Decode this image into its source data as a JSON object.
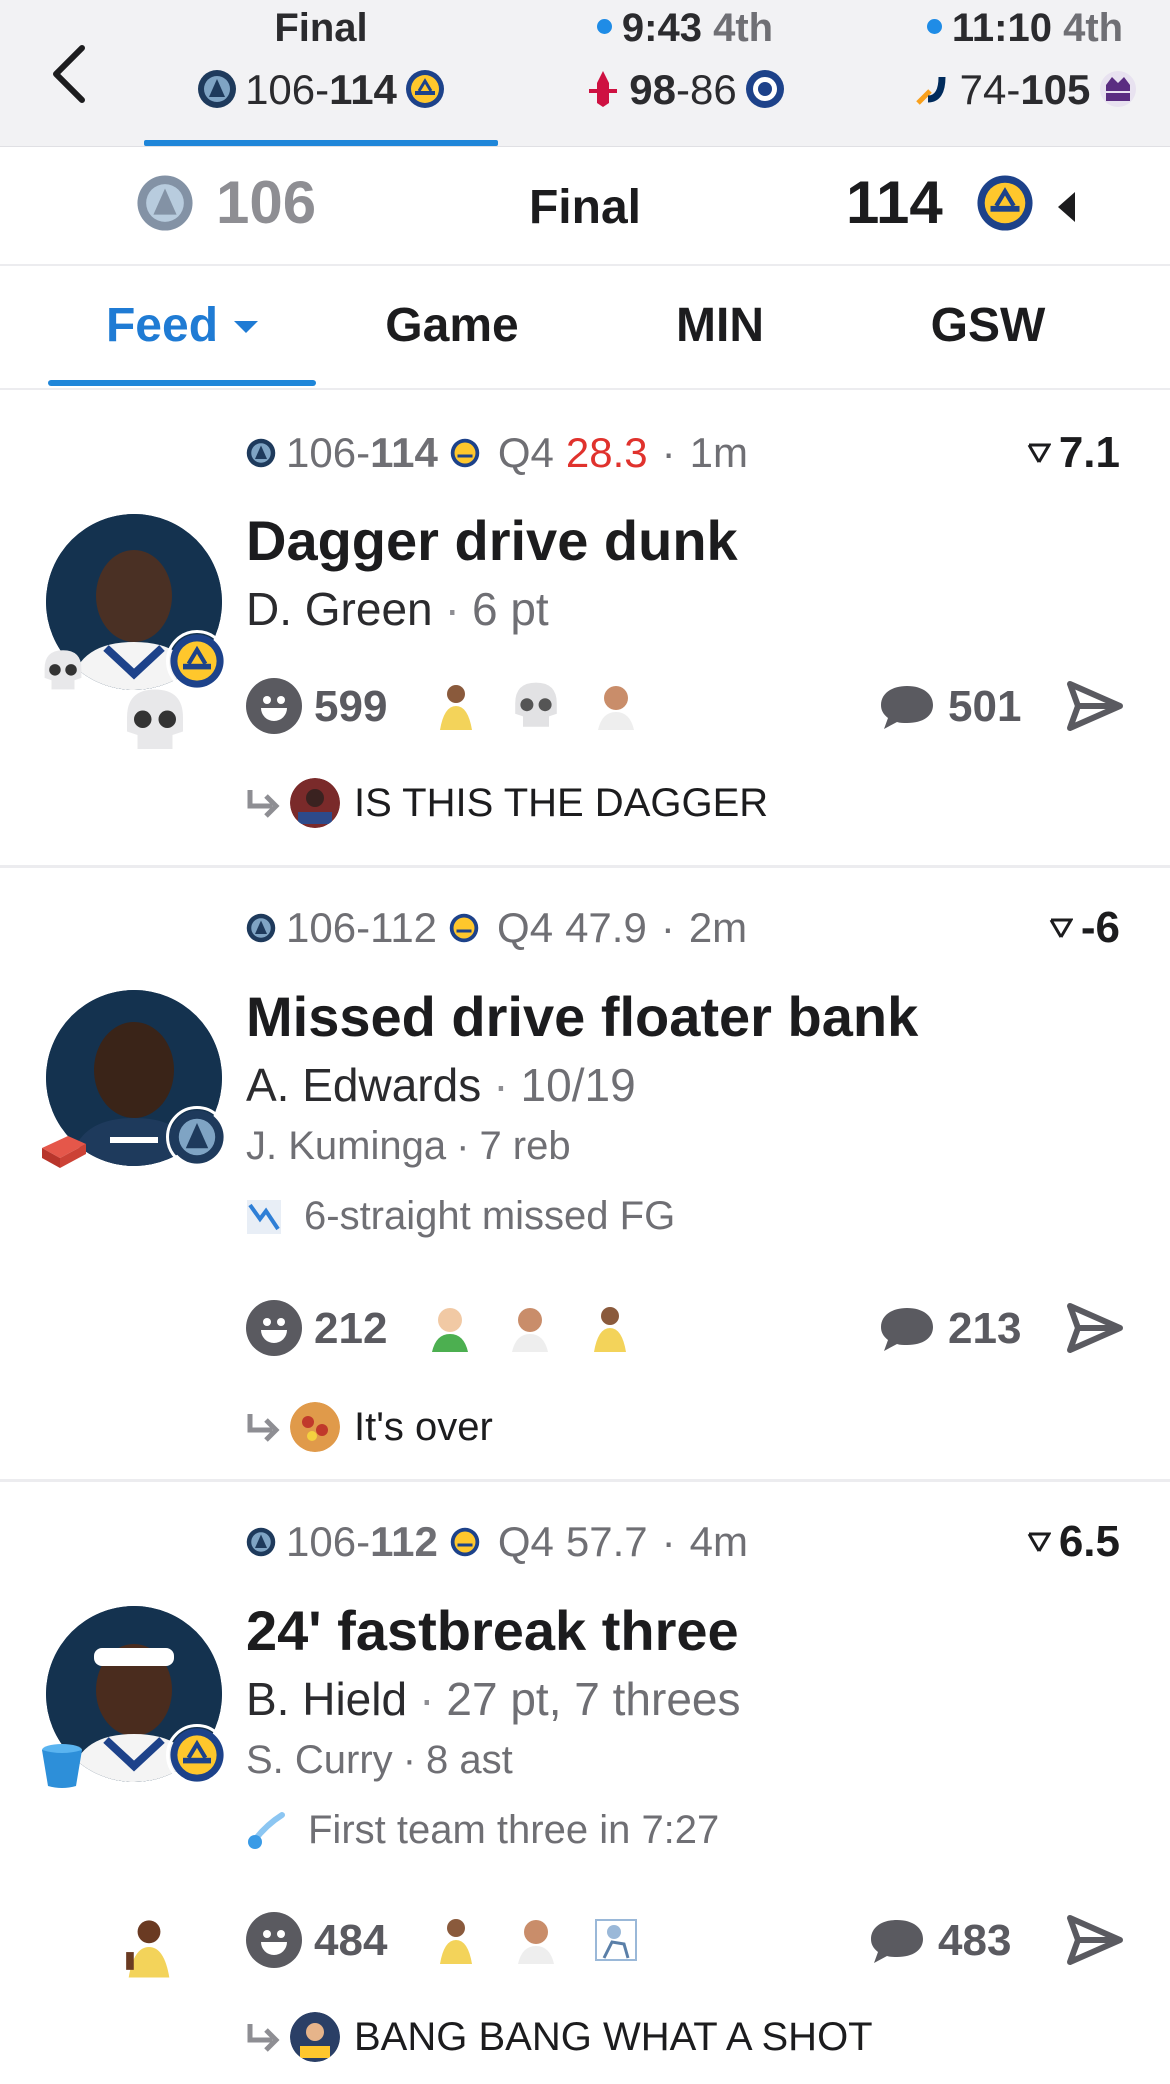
{
  "strip": {
    "games": [
      {
        "status": "Final",
        "period": "",
        "live": false,
        "away_score": "106",
        "home_score": "114",
        "away_team": "MIN",
        "home_team": "GSW"
      },
      {
        "status": "9:43",
        "period": "4th",
        "live": true,
        "away_score": "98",
        "home_score": "86",
        "away_team": "HOU",
        "home_team": "LAC"
      },
      {
        "status": "11:10",
        "period": "4th",
        "live": true,
        "away_score": "74",
        "home_score": "105",
        "away_team": "UTA",
        "home_team": "SAC"
      }
    ],
    "separator": "-"
  },
  "header": {
    "away_score": "106",
    "status": "Final",
    "home_score": "114"
  },
  "tabs": [
    {
      "label": "Feed",
      "active": true
    },
    {
      "label": "Game",
      "active": false
    },
    {
      "label": "MIN",
      "active": false
    },
    {
      "label": "GSW",
      "active": false
    }
  ],
  "feed": [
    {
      "score_away": "106",
      "score_home": "114",
      "winning": "home",
      "quarter": "Q4",
      "clock": "28.3",
      "clock_red": true,
      "ago": "1m",
      "win_prob": "7.1",
      "headline": "Dagger drive dunk",
      "player": "D. Green",
      "player_stat": "6 pt",
      "secondary": "",
      "secondary_stat": "",
      "note": "",
      "reactions": "599",
      "comments": "501",
      "reply": "IS THIS THE DAGGER",
      "emoji_badge": "skull-emoji"
    },
    {
      "score_away": "106",
      "score_home": "112",
      "winning": "",
      "quarter": "Q4",
      "clock": "47.9",
      "clock_red": false,
      "ago": "2m",
      "win_prob": "-6",
      "headline": "Missed drive floater bank",
      "player": "A. Edwards",
      "player_stat": "10/19",
      "secondary": "J. Kuminga",
      "secondary_stat": "7 reb",
      "note": "6-straight missed FG",
      "reactions": "212",
      "comments": "213",
      "reply": "It's over",
      "emoji_badge": "brick-emoji"
    },
    {
      "score_away": "106",
      "score_home": "112",
      "winning": "home",
      "quarter": "Q4",
      "clock": "57.7",
      "clock_red": false,
      "ago": "4m",
      "win_prob": "6.5",
      "headline": "24' fastbreak three",
      "player": "B. Hield",
      "player_stat": "27 pt, 7 threes",
      "secondary": "S. Curry",
      "secondary_stat": "8 ast",
      "note": "First team three in 7:27",
      "reactions": "484",
      "comments": "483",
      "reply": "BANG BANG WHAT A SHOT",
      "emoji_badge": "bucket-emoji"
    }
  ],
  "separators": {
    "dot": "·",
    "dash": "-"
  },
  "colors": {
    "accent": "#1f7bd4",
    "clock_red": "#e0322d",
    "muted": "#6f6f74"
  }
}
